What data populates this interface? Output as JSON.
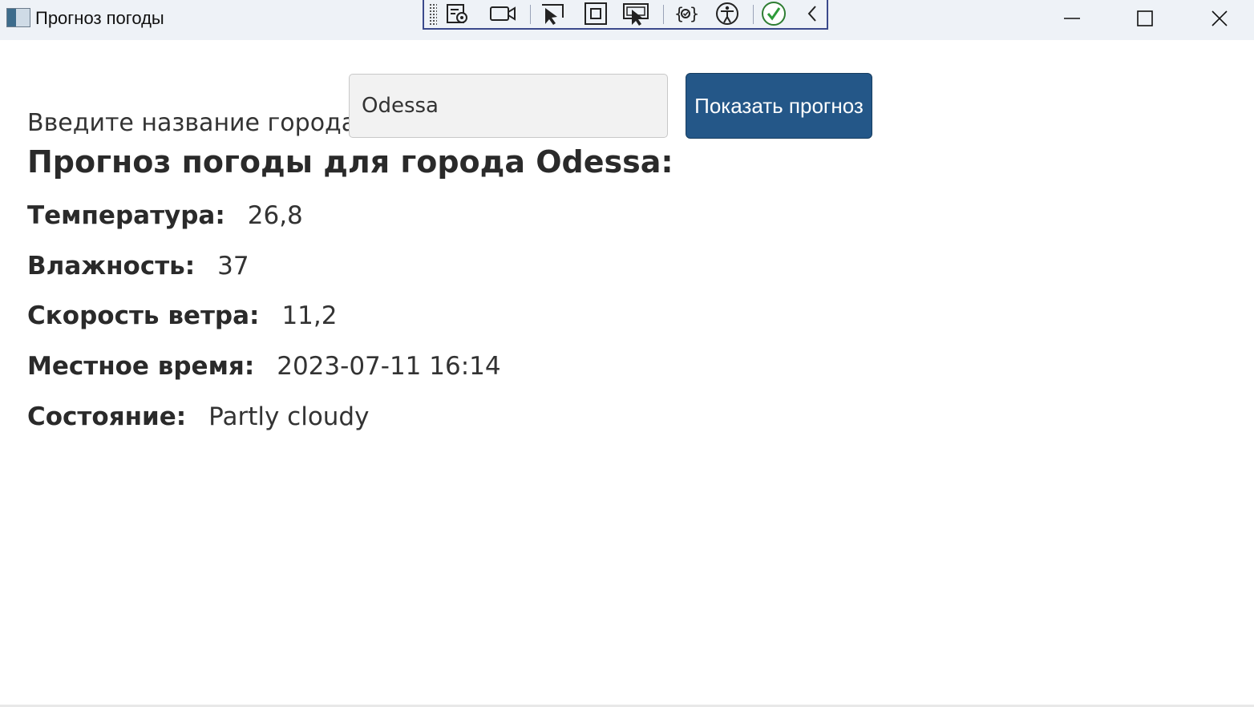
{
  "window": {
    "title": "Прогноз погоды"
  },
  "devtools": {
    "icons": [
      "grip-icon",
      "live-visual-tree-icon",
      "video-camera-icon",
      "select-element-icon",
      "display-layout-adorners-icon",
      "track-focus-icon",
      "binding-failures-icon",
      "accessibility-icon",
      "checkmark-icon",
      "collapse-chevron-icon"
    ]
  },
  "form": {
    "city_label": "Введите название города:",
    "city_value": "Odessa",
    "show_button": "Показать прогноз"
  },
  "forecast": {
    "heading": "Прогноз погоды для города Odessa:",
    "temperature_label": "Температура:",
    "temperature_value": "26,8",
    "humidity_label": "Влажность:",
    "humidity_value": "37",
    "wind_label": "Скорость ветра:",
    "wind_value": "11,2",
    "time_label": "Местное время:",
    "time_value": "2023-07-11 16:14",
    "condition_label": "Состояние:",
    "condition_value": "Partly cloudy"
  },
  "colors": {
    "titlebar": "#eef2f7",
    "button": "#245788",
    "input": "#f2f2f2"
  }
}
